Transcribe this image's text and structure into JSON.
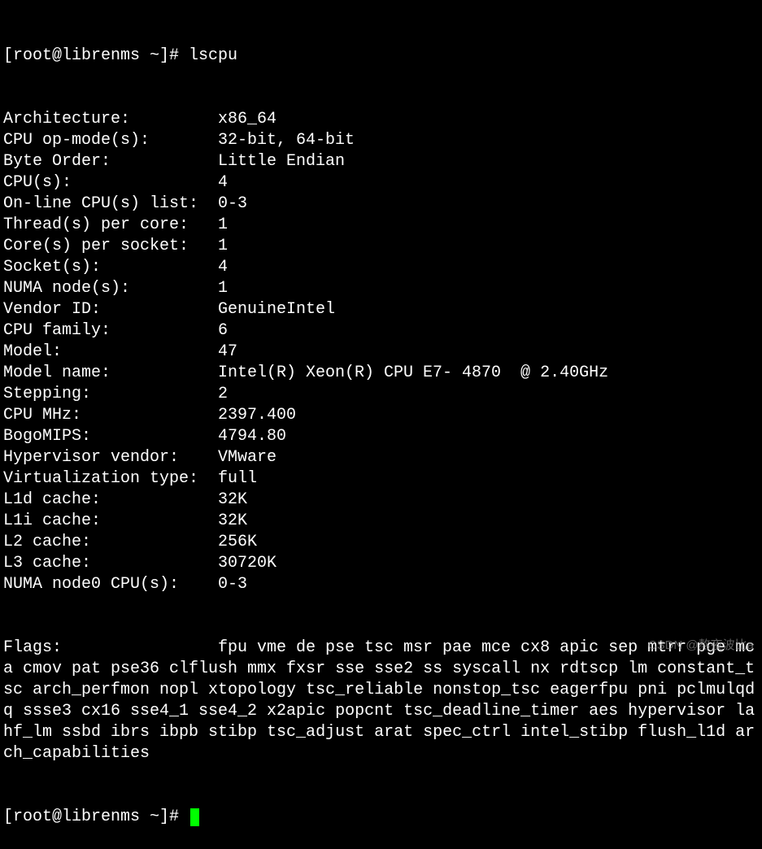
{
  "prompt1": "[root@librenms ~]# ",
  "command": "lscpu",
  "rows": [
    {
      "label": "Architecture:",
      "value": "x86_64"
    },
    {
      "label": "CPU op-mode(s):",
      "value": "32-bit, 64-bit"
    },
    {
      "label": "Byte Order:",
      "value": "Little Endian"
    },
    {
      "label": "CPU(s):",
      "value": "4"
    },
    {
      "label": "On-line CPU(s) list:",
      "value": "0-3"
    },
    {
      "label": "Thread(s) per core:",
      "value": "1"
    },
    {
      "label": "Core(s) per socket:",
      "value": "1"
    },
    {
      "label": "Socket(s):",
      "value": "4"
    },
    {
      "label": "NUMA node(s):",
      "value": "1"
    },
    {
      "label": "Vendor ID:",
      "value": "GenuineIntel"
    },
    {
      "label": "CPU family:",
      "value": "6"
    },
    {
      "label": "Model:",
      "value": "47"
    },
    {
      "label": "Model name:",
      "value": "Intel(R) Xeon(R) CPU E7- 4870  @ 2.40GHz"
    },
    {
      "label": "Stepping:",
      "value": "2"
    },
    {
      "label": "CPU MHz:",
      "value": "2397.400"
    },
    {
      "label": "BogoMIPS:",
      "value": "4794.80"
    },
    {
      "label": "Hypervisor vendor:",
      "value": "VMware"
    },
    {
      "label": "Virtualization type:",
      "value": "full"
    },
    {
      "label": "L1d cache:",
      "value": "32K"
    },
    {
      "label": "L1i cache:",
      "value": "32K"
    },
    {
      "label": "L2 cache:",
      "value": "256K"
    },
    {
      "label": "L3 cache:",
      "value": "30720K"
    },
    {
      "label": "NUMA node0 CPU(s):",
      "value": "0-3"
    }
  ],
  "flags_label": "Flags:",
  "flags_value": "fpu vme de pse tsc msr pae mce cx8 apic sep mtrr pge mca cmov pat pse36 clflush mmx fxsr sse sse2 ss syscall nx rdtscp lm constant_tsc arch_perfmon nopl xtopology tsc_reliable nonstop_tsc eagerfpu pni pclmulqdq ssse3 cx16 sse4_1 sse4_2 x2apic popcnt tsc_deadline_timer aes hypervisor lahf_lm ssbd ibrs ibpb stibp tsc_adjust arat spec_ctrl intel_stibp flush_l1d arch_capabilities",
  "prompt2": "[root@librenms ~]# ",
  "watermark": "CSDN @熬夜波比a"
}
